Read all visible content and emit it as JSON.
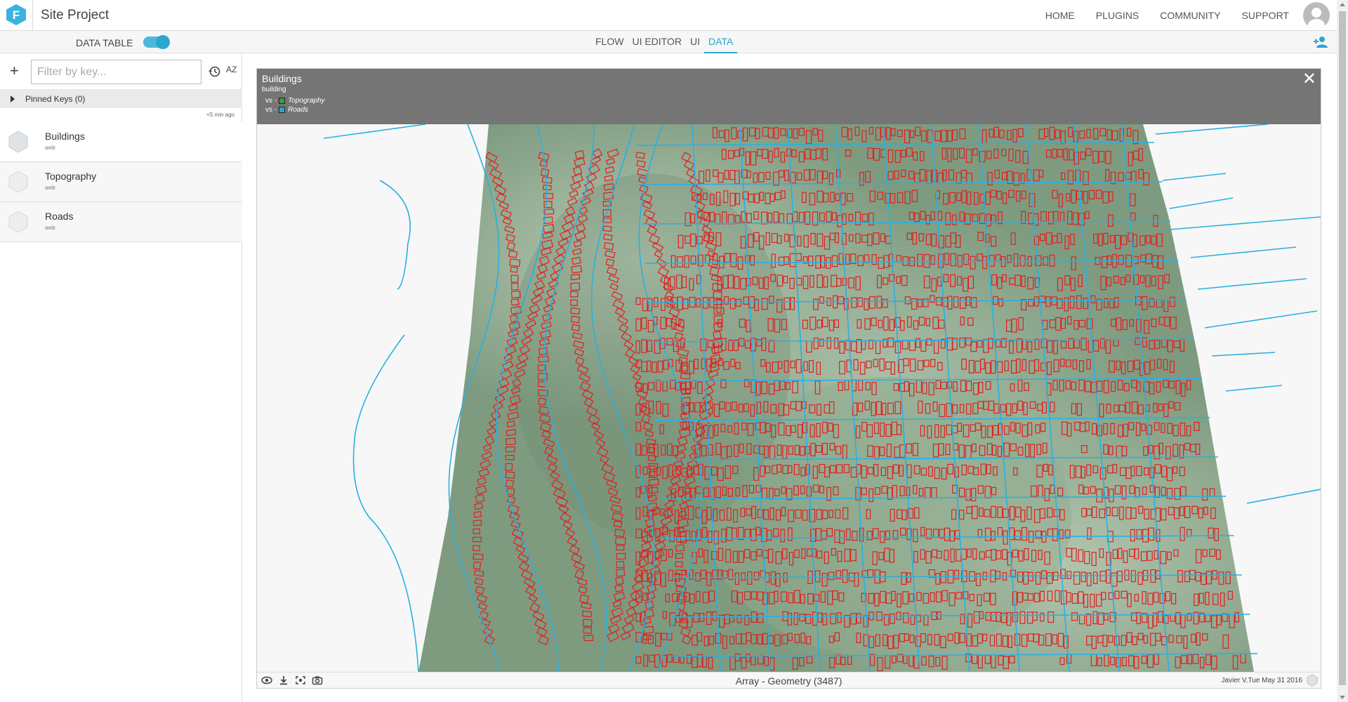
{
  "header": {
    "logo_letter": "F",
    "app_title": "Site Project",
    "nav": [
      "HOME",
      "PLUGINS",
      "COMMUNITY",
      "SUPPORT"
    ]
  },
  "subbar": {
    "data_table_label": "DATA TABLE",
    "data_table_on": true,
    "modes": [
      "FLOW",
      "UI EDITOR",
      "UI",
      "DATA"
    ],
    "active_mode": "DATA"
  },
  "sidebar": {
    "filter_placeholder": "Filter by key...",
    "sort_label": "AZ",
    "pinned_label": "Pinned Keys (0)",
    "updated": "<5 min ago",
    "items": [
      {
        "name": "Buildings",
        "sub": "web"
      },
      {
        "name": "Topography",
        "sub": "web"
      },
      {
        "name": "Roads",
        "sub": "web"
      }
    ]
  },
  "viewer": {
    "title": "Buildings",
    "subtitle": "building",
    "legend": [
      {
        "prefix": "vs -",
        "name": "Topography",
        "color": "#3a9a4a"
      },
      {
        "prefix": "vs -",
        "name": "Roads",
        "color": "#2aa6cf"
      }
    ],
    "footer_center": "Array - Geometry (3487)",
    "footer_right": "Javier V.Tue May 31 2016"
  },
  "colors": {
    "accent": "#2aa6cf",
    "building": "#e02020",
    "road": "#2ab0e0",
    "terrain": "#8aa88c"
  }
}
